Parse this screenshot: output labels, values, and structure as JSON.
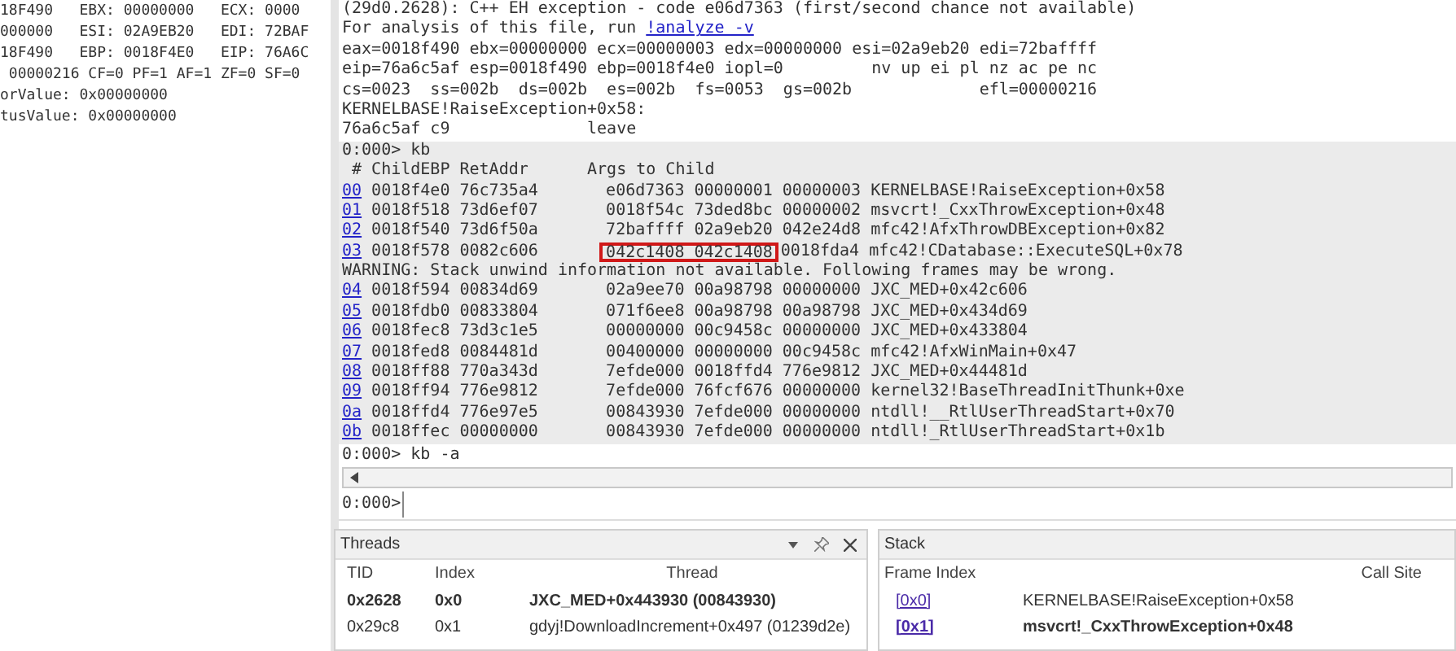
{
  "registers_pane": {
    "lines": [
      "18F490   EBX: 00000000   ECX: 0000",
      "000000   ESI: 02A9EB20   EDI: 72BAF",
      "18F490   EBP: 0018F4E0   EIP: 76A6C",
      " 00000216 CF=0 PF=1 AF=1 ZF=0 SF=0",
      "orValue: 0x00000000",
      "tusValue: 0x00000000"
    ]
  },
  "command_output": {
    "lines": [
      {
        "kind": "text",
        "text": "(29d0.2628): C++ EH exception - code e06d7363 (first/second chance not available)"
      },
      {
        "kind": "link_line",
        "text": "For analysis of this file, run ",
        "link": "!analyze -v"
      },
      {
        "kind": "text",
        "text": "eax=0018f490 ebx=00000000 ecx=00000003 edx=00000000 esi=02a9eb20 edi=72baffff"
      },
      {
        "kind": "text",
        "text": "eip=76a6c5af esp=0018f490 ebp=0018f4e0 iopl=0         nv up ei pl nz ac pe nc"
      },
      {
        "kind": "text",
        "text": "cs=0023  ss=002b  ds=002b  es=002b  fs=0053  gs=002b             efl=00000216"
      },
      {
        "kind": "text",
        "text": "KERNELBASE!RaiseException+0x58:"
      },
      {
        "kind": "text",
        "text": "76a6c5af c9              leave"
      }
    ],
    "block_lines": [
      {
        "kind": "text",
        "text": "0:000> kb"
      },
      {
        "kind": "text",
        "text": " # ChildEBP RetAddr      Args to Child"
      },
      {
        "kind": "frame",
        "num": "00",
        "addrs": "0018f4e0 76c735a4",
        "args": [
          "e06d7363",
          "00000001",
          "00000003"
        ],
        "call_site": "KERNELBASE!RaiseException+0x58",
        "marked": false
      },
      {
        "kind": "frame",
        "num": "01",
        "addrs": "0018f518 73d6ef07",
        "args": [
          "0018f54c",
          "73ded8bc",
          "00000002"
        ],
        "call_site": "msvcrt!_CxxThrowException+0x48",
        "marked": false
      },
      {
        "kind": "frame",
        "num": "02",
        "addrs": "0018f540 73d6f50a",
        "args": [
          "72baffff",
          "02a9eb20",
          "042e24d8"
        ],
        "call_site": "mfc42!AfxThrowDBException+0x82",
        "marked": false
      },
      {
        "kind": "frame",
        "num": "03",
        "addrs": "0018f578 0082c606",
        "args": [
          "042c1408",
          "042c1408",
          "0018fda4"
        ],
        "call_site": "mfc42!CDatabase::ExecuteSQL+0x78",
        "marked": true
      },
      {
        "kind": "text",
        "text": "WARNING: Stack unwind information not available. Following frames may be wrong."
      },
      {
        "kind": "frame",
        "num": "04",
        "addrs": "0018f594 00834d69",
        "args": [
          "02a9ee70",
          "00a98798",
          "00000000"
        ],
        "call_site": "JXC_MED+0x42c606",
        "marked": false
      },
      {
        "kind": "frame",
        "num": "05",
        "addrs": "0018fdb0 00833804",
        "args": [
          "071f6ee8",
          "00a98798",
          "00a98798"
        ],
        "call_site": "JXC_MED+0x434d69",
        "marked": false
      },
      {
        "kind": "frame",
        "num": "06",
        "addrs": "0018fec8 73d3c1e5",
        "args": [
          "00000000",
          "00c9458c",
          "00000000"
        ],
        "call_site": "JXC_MED+0x433804",
        "marked": false
      },
      {
        "kind": "frame",
        "num": "07",
        "addrs": "0018fed8 0084481d",
        "args": [
          "00400000",
          "00000000",
          "00c9458c"
        ],
        "call_site": "mfc42!AfxWinMain+0x47",
        "marked": false
      },
      {
        "kind": "frame",
        "num": "08",
        "addrs": "0018ff88 770a343d",
        "args": [
          "7efde000",
          "0018ffd4",
          "776e9812"
        ],
        "call_site": "JXC_MED+0x44481d",
        "marked": false
      },
      {
        "kind": "frame",
        "num": "09",
        "addrs": "0018ff94 776e9812",
        "args": [
          "7efde000",
          "76fcf676",
          "00000000"
        ],
        "call_site": "kernel32!BaseThreadInitThunk+0xe",
        "marked": false
      },
      {
        "kind": "frame",
        "num": "0a",
        "addrs": "0018ffd4 776e97e5",
        "args": [
          "00843930",
          "7efde000",
          "00000000"
        ],
        "call_site": "ntdll!__RtlUserThreadStart+0x70",
        "marked": false
      },
      {
        "kind": "frame",
        "num": "0b",
        "addrs": "0018ffec 00000000",
        "args": [
          "00843930",
          "7efde000",
          "00000000"
        ],
        "call_site": "ntdll!_RtlUserThreadStart+0x1b",
        "marked": false
      }
    ],
    "last_line": "0:000> kb -a"
  },
  "command_prompt": "0:000>",
  "threads": {
    "title": "Threads",
    "columns": [
      "TID",
      "Index",
      "Thread"
    ],
    "rows": [
      {
        "tid": "0x2628",
        "index": "0x0",
        "thread": "JXC_MED+0x443930 (00843930)",
        "selected": true
      },
      {
        "tid": "0x29c8",
        "index": "0x1",
        "thread": "gdyj!DownloadIncrement+0x497 (01239d2e)",
        "selected": false
      }
    ]
  },
  "stack": {
    "title": "Stack",
    "columns": [
      "Frame Index",
      "Call Site"
    ],
    "rows": [
      {
        "frame": "[0x0]",
        "call_site": "KERNELBASE!RaiseException+0x58",
        "selected": false
      },
      {
        "frame": "[0x1]",
        "call_site": "msvcrt!_CxxThrowException+0x48",
        "selected": true
      }
    ]
  }
}
